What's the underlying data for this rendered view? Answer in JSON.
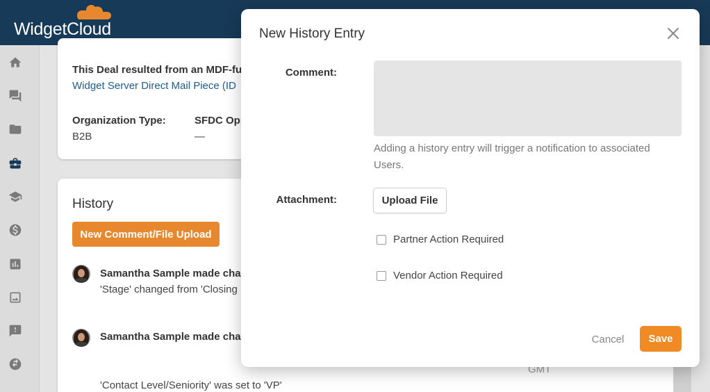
{
  "app": {
    "logo_text": "WidgetCloud",
    "brand_color": "#173a58",
    "accent_color": "#f08a24"
  },
  "sidenav": {
    "items": [
      {
        "icon": "home-icon"
      },
      {
        "icon": "chat-icon"
      },
      {
        "icon": "folder-icon"
      },
      {
        "icon": "briefcase-icon",
        "active": true
      },
      {
        "icon": "graduation-cap-icon"
      },
      {
        "icon": "dollar-icon"
      },
      {
        "icon": "bar-chart-icon"
      },
      {
        "icon": "image-icon"
      },
      {
        "icon": "alert-message-icon"
      },
      {
        "icon": "swap-icon"
      }
    ]
  },
  "deal_card": {
    "mdf_text": "This Deal resulted from an MDF-fur",
    "mdf_link": "Widget Server Direct Mail Piece (ID",
    "org_type_label": "Organization Type:",
    "org_type_value": "B2B",
    "sfdc_label": "SFDC Opp",
    "sfdc_value": "—"
  },
  "history": {
    "title": "History",
    "new_button_label": "New Comment/File Upload",
    "entries": [
      {
        "author_line": "Samantha Sample made chan",
        "detail": "'Stage' changed from 'Closing"
      },
      {
        "author_line": "Samantha Sample made chan",
        "detail": "'Contact Level/Seniority' was set to 'VP'",
        "timezone": "GMT"
      }
    ]
  },
  "modal": {
    "title": "New History Entry",
    "comment_label": "Comment:",
    "comment_value": "",
    "help_text": "Adding a history entry will trigger a notification to associated Users.",
    "attachment_label": "Attachment:",
    "upload_label": "Upload File",
    "partner_action_label": "Partner Action Required",
    "vendor_action_label": "Vendor Action Required",
    "cancel_label": "Cancel",
    "save_label": "Save"
  }
}
